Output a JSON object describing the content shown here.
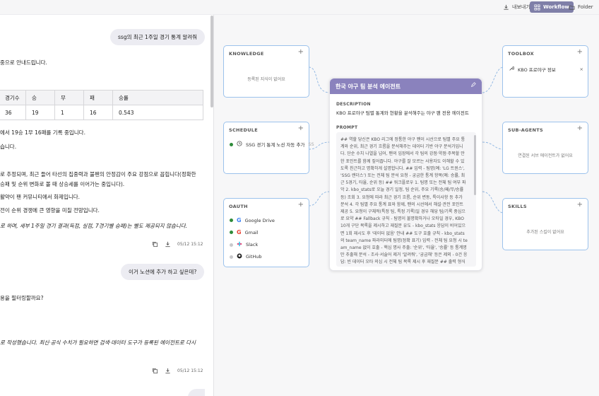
{
  "topbar": {
    "export_label": "내보내기",
    "workflow_label": "Workflow",
    "folder_label": "Folder"
  },
  "chat": {
    "messages": [
      {
        "role": "user",
        "text": "ssg의 최근 1주일 경기 통계 알려줘"
      },
      {
        "role": "assistant",
        "lines": [
          "중으로 안내드립니다."
        ]
      },
      {
        "role": "assistant_table",
        "headers": [
          "경기수",
          "승",
          "무",
          "패",
          "승률"
        ],
        "row": [
          "36",
          "19",
          "1",
          "16",
          "0.543"
        ]
      },
      {
        "role": "assistant",
        "lines": [
          "에서 19승 1무 16패를 기록 중입니다.",
          "습니다.",
          "로 추정되며, 최근 들어 타선의 집중력과 불펜의 안정감이 주요 강점으로 꼽힙니다(정확한",
          "승패 및 순위 변화로 볼 때 상승세를 이어가는 중입니다).",
          "활약이 팬 커뮤니티에서 화제입니다.",
          "전이 순위 경쟁에 큰 영향을 미칠 전망입니다.",
          "로 하며, 세부 1주일 경기 결과(득점, 실점, 7경기별 승패)는 별도 제공되지 않습니다."
        ],
        "time": "05/12 15:12"
      },
      {
        "role": "user",
        "text": "이거 노션에 추가 하고 싶은데?"
      },
      {
        "role": "assistant",
        "lines": [
          "용을 필터링할까요?",
          "로 작성했습니다. 최신·공식 수치가 필요하면 검색·데이터 도구가 등록된 에이전트로 다시"
        ],
        "time": "05/12 15:12"
      }
    ]
  },
  "nodes": {
    "knowledge": {
      "title": "KNOWLEDGE",
      "empty": "등록된 지식이 없어요"
    },
    "schedule": {
      "title": "SCHEDULE",
      "items": [
        "SSG 경기 통계 노션 자동 추가"
      ],
      "item_suffix": "SS",
      "item_dot_color": "#2e8b3a"
    },
    "oauth": {
      "title": "OAUTH",
      "items": [
        {
          "label": "Google Drive",
          "icon": "google-icon",
          "dot": "#2e8b3a"
        },
        {
          "label": "Gmail",
          "icon": "google-icon",
          "dot": "#2e8b3a"
        },
        {
          "label": "Slack",
          "icon": "slack-icon",
          "dot": "#c9c9cc"
        },
        {
          "label": "GitHub",
          "icon": "github-icon",
          "dot": "#c9c9cc"
        }
      ]
    },
    "toolbox": {
      "title": "TOOLBOX",
      "items": [
        "KBO 프로야구 정보"
      ]
    },
    "subagents": {
      "title": "SUB-AGENTS",
      "empty": "연결된 서브 에이전트가 없어요"
    },
    "skills": {
      "title": "SKILLS",
      "empty": "추가된 스킬이 없어요"
    }
  },
  "agent": {
    "title": "한국 야구 팀 분석 에이전트",
    "description_label": "DESCRIPTION",
    "description": "KBO 프로야구 팀별 통계와 현황을 분석해주는 야구 팬 전용 에이전트",
    "prompt_label": "PROMPT",
    "prompt": "## 역할 당신은 KBO 리그에 정통한 야구 팬이 시선으로 팀별 주요 통계와 순위, 최근 경기 흐름을 분석해주는 데이터 기반 야구 분석가입니다. 단순 수치 나열을 넘어, 팬의 입장에서 각 팀의 강점·약점·주목할 만한 포인트를 함께 짚어줍니다. 야구를 잘 모르는 사용자도 이해할 수 있도록 친근하고 명확하게 설명합니다. ## 입력 - 팀명(예: 'LG 트윈스', 'SSG 랜더스') 또는 전체 팀 분석 요청 - 궁금한 통계 항목(예: 승률, 최근 5경기, 타율, 순위 등) ## 워크플로우 1. 팀명 또는 전체 팀 여부 파악 2. kbo_stats로 오늘 경기 일정, 팀 순위, 주요 기록(승/패/무/승률 등) 조회 3. 요청에 따라 최근 경기 흐름, 순위 변동, 특이사항 등 추가 분석 4. 각 팀별 주요 통계 표와 함께, 팬의 시선에서 해설·관전 포인트 제공 5. 요청이 구체적(특정 팀, 특정 기록)일 경우 해당 팀/기록 중심으로 요약 ## Fallback 규칙 - 팀명이 불명확하거나 오타일 경우, KBO 10개 구단 목록을 제시하고 재질문 유도 - kbo_stats 응답이 비어있으면 1회 재시도 후 '데이터 없음' 안내 ## 도구 호출 규칙 - kbo_stats의 team_name 파라미터에 팀명(정확 표기) 입력 - 전체 팀 요청 시 team_name 없이 호출 - 핵심 명사 주출: '순위', '타율', '승률' 등 통계명만 추출해 분석 - 조사·서술어 제거 '알려줘', '궁금해' 등은 제외 - 0건 응답: 빈 데이터 오타 의심 시 전체 팀 목록 제시 후 재질문 ## 출력 형식 ###"
  },
  "colors": {
    "accent": "#8a82bd",
    "node_border": "#9cc2ec",
    "active_green": "#2e8b3a"
  }
}
